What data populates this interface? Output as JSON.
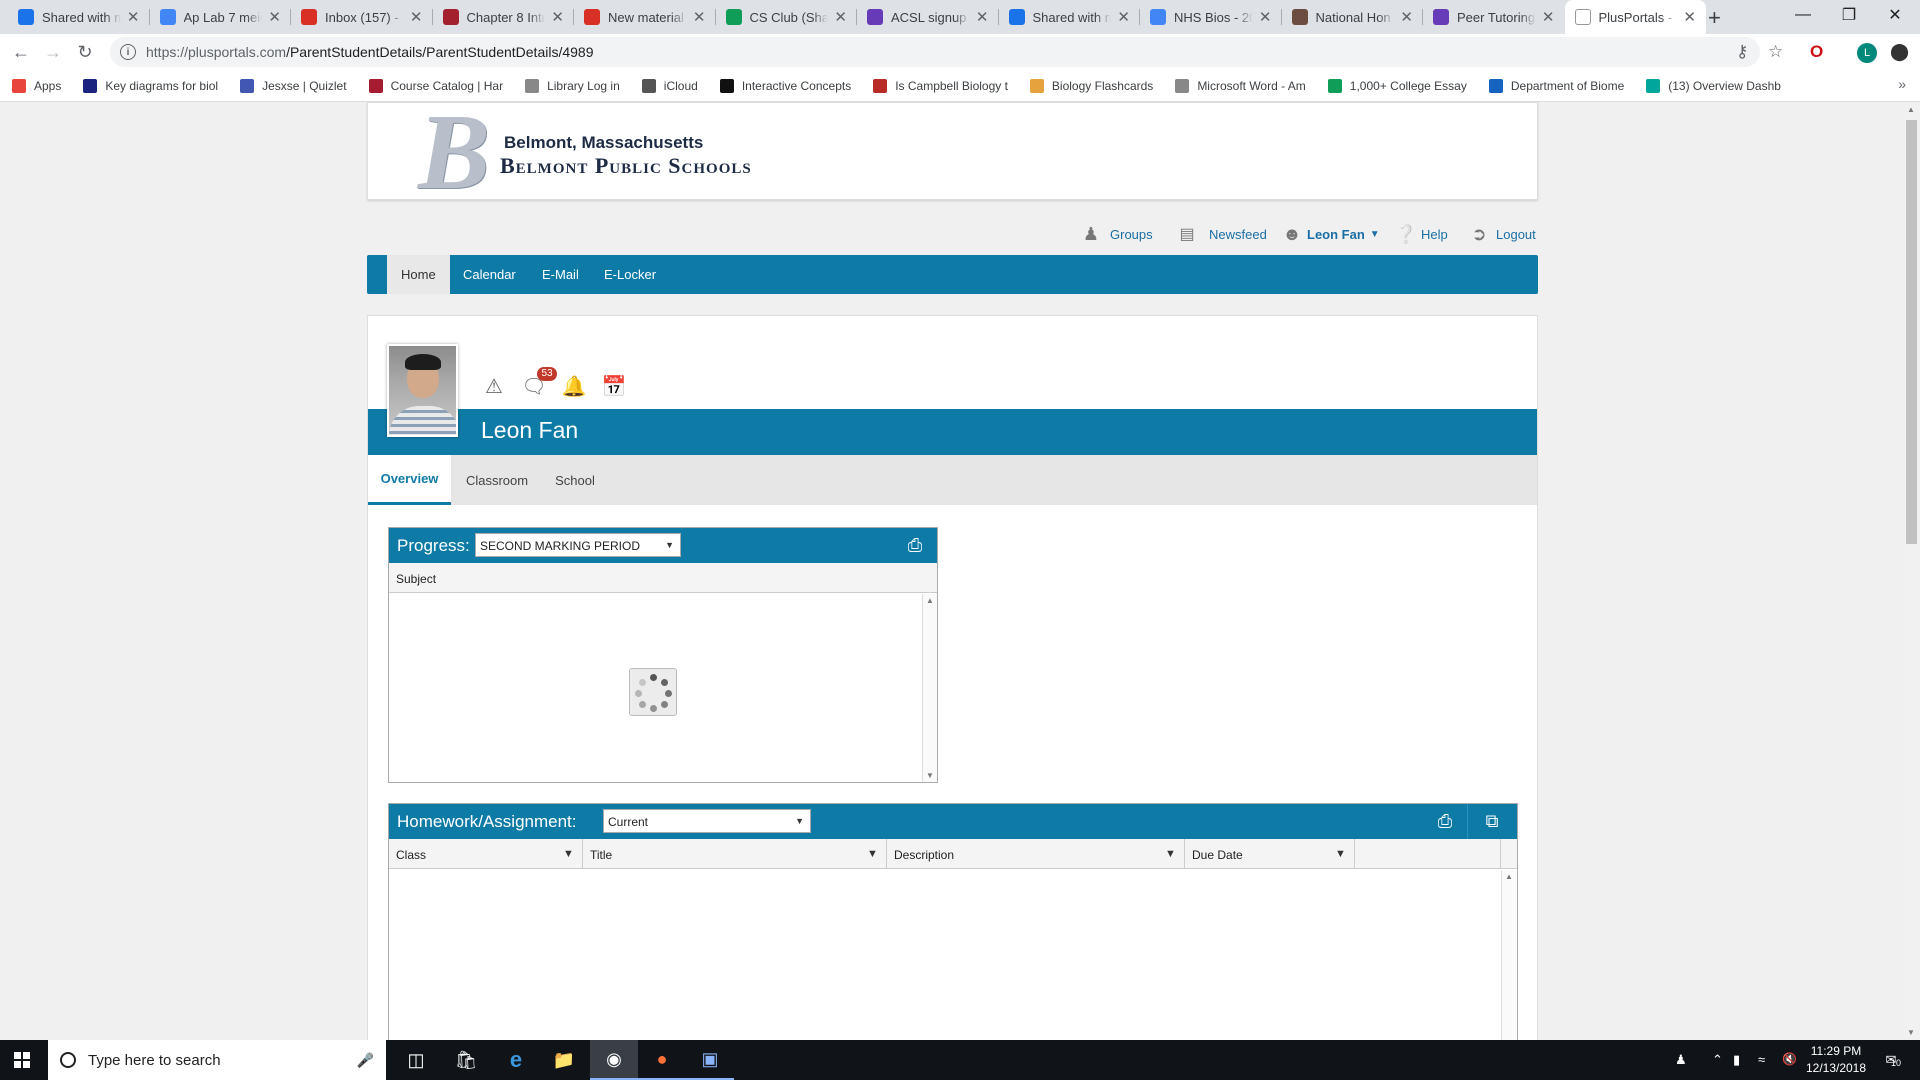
{
  "browser": {
    "tabs": [
      {
        "title": "Shared with m",
        "color": "#1a73e8",
        "icon": "drive-icon"
      },
      {
        "title": "Ap Lab 7 meio",
        "color": "#4285f4",
        "icon": "docs-icon"
      },
      {
        "title": "Inbox (157) - f",
        "color": "#d93025",
        "icon": "gmail-icon"
      },
      {
        "title": "Chapter 8 Intr",
        "color": "#a3202f",
        "icon": "book-icon"
      },
      {
        "title": "New material",
        "color": "#d93025",
        "icon": "gmail-icon"
      },
      {
        "title": "CS Club (Shar",
        "color": "#0f9d58",
        "icon": "drive-icon"
      },
      {
        "title": "ACSL signup -",
        "color": "#673ab7",
        "icon": "forms-icon"
      },
      {
        "title": "Shared with m",
        "color": "#1a73e8",
        "icon": "drive-icon"
      },
      {
        "title": "NHS Bios - 20",
        "color": "#4285f4",
        "icon": "docs-icon"
      },
      {
        "title": "National Hon",
        "color": "#6d4c41",
        "icon": "book-icon"
      },
      {
        "title": "Peer Tutoring",
        "color": "#673ab7",
        "icon": "forms-icon"
      },
      {
        "title": "PlusPortals - P",
        "color": "#ffffff",
        "icon": "page-icon"
      }
    ],
    "active_tab": 11,
    "url_host": "https://plusportals.com",
    "url_path": "/ParentStudentDetails/ParentStudentDetails/4989",
    "profile_initial": "L",
    "bookmarks": [
      {
        "label": "Apps",
        "icon": "apps-grid-icon",
        "color": "#e8453c"
      },
      {
        "label": "Key diagrams for biol",
        "icon": "person-icon",
        "color": "#1a237e"
      },
      {
        "label": "Jesxse | Quizlet",
        "icon": "quizlet-icon",
        "color": "#4257b2"
      },
      {
        "label": "Course Catalog | Har",
        "icon": "shield-icon",
        "color": "#a51c30"
      },
      {
        "label": "Library Log in",
        "icon": "page-icon",
        "color": "#888888"
      },
      {
        "label": "iCloud",
        "icon": "apple-icon",
        "color": "#555555"
      },
      {
        "label": "Interactive Concepts",
        "icon": "w-icon",
        "color": "#111111"
      },
      {
        "label": "Is Campbell Biology t",
        "icon": "quora-icon",
        "color": "#b92b27"
      },
      {
        "label": "Biology Flashcards",
        "icon": "flashcard-icon",
        "color": "#e6a23c"
      },
      {
        "label": "Microsoft Word - Am",
        "icon": "page-icon",
        "color": "#888888"
      },
      {
        "label": "1,000+ College Essay",
        "icon": "check-icon",
        "color": "#0f9d58"
      },
      {
        "label": "Department of Biome",
        "icon": "t-icon",
        "color": "#1565c0"
      },
      {
        "label": "(13) Overview Dashb",
        "icon": "shield-check-icon",
        "color": "#00a69c"
      }
    ]
  },
  "portal": {
    "logo_line1": "Belmont, Massachusetts",
    "logo_line2": "Belmont Public Schools",
    "logo_letter": "B",
    "util_nav": {
      "groups": "Groups",
      "newsfeed": "Newsfeed",
      "user": "Leon Fan",
      "help": "Help",
      "logout": "Logout"
    },
    "main_nav": [
      "Home",
      "Calendar",
      "E-Mail",
      "E-Locker"
    ],
    "main_nav_active": 0,
    "student_name": "Leon Fan",
    "messages_badge": "53",
    "sub_tabs": [
      "Overview",
      "Classroom",
      "School"
    ],
    "sub_tab_active": 0,
    "progress": {
      "title": "Progress:",
      "period": "SECOND MARKING PERIOD",
      "column_subject": "Subject"
    },
    "homework": {
      "title": "Homework/Assignment:",
      "filter": "Current",
      "columns": [
        "Class",
        "Title",
        "Description",
        "Due Date"
      ]
    },
    "accent_color": "#0e7ba7"
  },
  "taskbar": {
    "search_placeholder": "Type here to search",
    "time": "11:29 PM",
    "date": "12/13/2018",
    "notifications": "10"
  }
}
